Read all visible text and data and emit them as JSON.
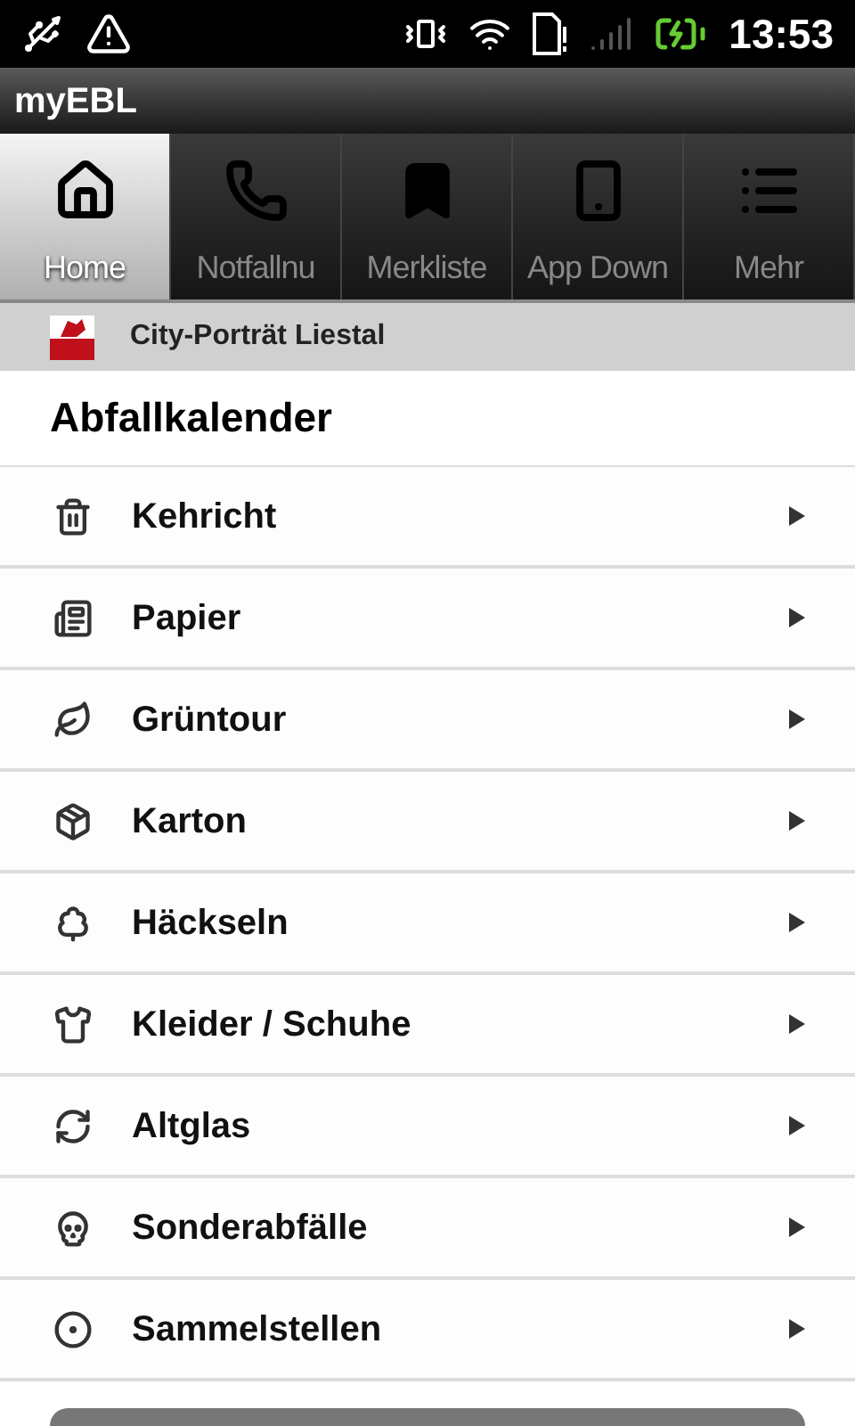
{
  "status_bar": {
    "time": "13:53"
  },
  "app_bar": {
    "title": "myEBL"
  },
  "tabs": [
    {
      "label": "Home",
      "selected": true
    },
    {
      "label": "Notfallnu",
      "selected": false
    },
    {
      "label": "Merkliste",
      "selected": false
    },
    {
      "label": "App Down",
      "selected": false
    },
    {
      "label": "Mehr",
      "selected": false
    }
  ],
  "location_bar": {
    "label": "City-Porträt Liestal"
  },
  "section": {
    "title": "Abfallkalender"
  },
  "items": [
    {
      "label": "Kehricht"
    },
    {
      "label": "Papier"
    },
    {
      "label": "Grüntour"
    },
    {
      "label": "Karton"
    },
    {
      "label": "Häckseln"
    },
    {
      "label": "Kleider / Schuhe"
    },
    {
      "label": "Altglas"
    },
    {
      "label": "Sonderabfälle"
    },
    {
      "label": "Sammelstellen"
    }
  ]
}
